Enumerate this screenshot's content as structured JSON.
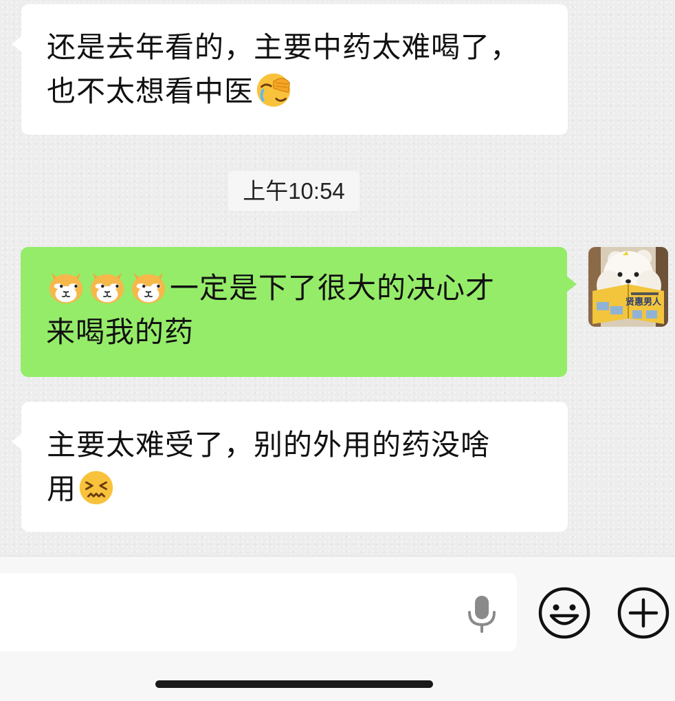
{
  "messages": [
    {
      "direction": "incoming",
      "lines": [
        "还是去年看的，主要中药太难喝了，",
        "也不太想看中医"
      ],
      "trailing_emoji": "face-palm-crying-emoji"
    },
    {
      "type": "timestamp",
      "text": "上午10:54"
    },
    {
      "direction": "outgoing",
      "leading_emojis": [
        "doge-cat-emoji",
        "doge-cat-emoji",
        "doge-cat-emoji"
      ],
      "lines": [
        "一定是下了很大的决心才",
        "来喝我的药"
      ],
      "avatar": {
        "book_text": "贤惠男人"
      }
    },
    {
      "direction": "incoming",
      "lines": [
        "主要太难受了，别的外用的药没啥",
        "用"
      ],
      "trailing_emoji": "confounded-face-emoji"
    }
  ],
  "input_bar": {
    "value": "",
    "icons": [
      "microphone-icon",
      "emoji-icon",
      "plus-icon"
    ]
  },
  "colors": {
    "incoming_bubble": "#ffffff",
    "outgoing_bubble": "#95ec69",
    "chat_background": "#ededed",
    "input_bar_background": "#f7f7f7"
  }
}
